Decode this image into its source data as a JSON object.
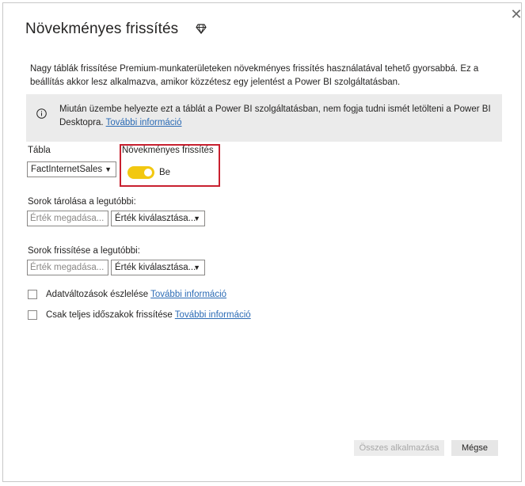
{
  "dialog": {
    "title": "Növekményes frissítés",
    "premium_icon": "diamond-icon",
    "close_icon": "close-icon",
    "description": "Nagy táblák frissítése Premium-munkaterületeken növekményes frissítés használatával tehető gyorsabbá. Ez a beállítás akkor lesz alkalmazva, amikor közzétesz egy jelentést a Power BI szolgáltatásban."
  },
  "info": {
    "icon": "info-icon",
    "text": "Miután üzembe helyezte ezt a táblát a Power BI szolgáltatásban, nem fogja tudni ismét letölteni a Power BI Desktopra.",
    "link": "További információ"
  },
  "table": {
    "label": "Tábla",
    "value": "FactInternetSales"
  },
  "incremental": {
    "label": "Növekményes frissítés",
    "state_label": "Be",
    "on": true
  },
  "store_rows": {
    "label": "Sorok tárolása a legutóbbi:",
    "input_placeholder": "Érték megadása...",
    "select_placeholder": "Érték kiválasztása..."
  },
  "refresh_rows": {
    "label": "Sorok frissítése a legutóbbi:",
    "input_placeholder": "Érték megadása...",
    "select_placeholder": "Érték kiválasztása..."
  },
  "options": {
    "detect_changes": {
      "label": "Adatváltozások észlelése",
      "link": "További információ"
    },
    "complete_periods": {
      "label": "Csak teljes időszakok frissítése",
      "link": "További információ"
    }
  },
  "buttons": {
    "apply_all": "Összes alkalmazása",
    "cancel": "Mégse"
  },
  "colors": {
    "accent_toggle": "#f2c811",
    "highlight_border": "#c8202f",
    "link": "#2b6bb5",
    "info_bg": "#ebebeb"
  }
}
